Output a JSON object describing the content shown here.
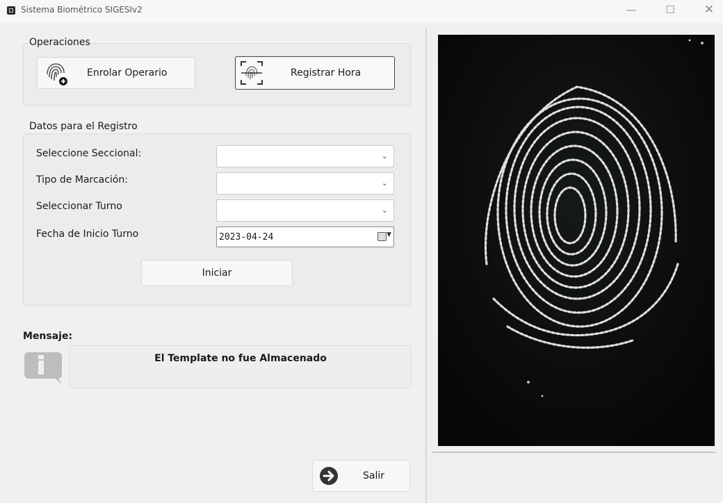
{
  "window": {
    "title": "Sistema Biométrico SIGESIv2",
    "min_glyph": "—",
    "max_glyph": "☐",
    "close_glyph": "✕"
  },
  "operations": {
    "title": "Operaciones",
    "enroll_label": "Enrolar Operario",
    "enroll_icon": "fingerprint-add-icon",
    "register_label": "Registrar Hora",
    "register_icon": "fingerprint-scan-icon"
  },
  "registro": {
    "title": "Datos para el Registro",
    "fields": [
      {
        "label": "Seleccione Seccional:",
        "value": ""
      },
      {
        "label": "Tipo de Marcación:",
        "value": ""
      },
      {
        "label": "Seleccionar Turno",
        "value": ""
      }
    ],
    "date_label": "Fecha de Inicio Turno",
    "date_value": "2023-04-24",
    "start_label": "Iniciar"
  },
  "message": {
    "title": "Mensaje:",
    "text": "El Template no fue Almacenado",
    "icon": "info-icon"
  },
  "exit": {
    "label": "Salir",
    "icon": "exit-arrow-icon"
  },
  "fingerprint": {
    "icon": "fingerprint-image"
  },
  "colors": {
    "background": "#f0f0f0",
    "image_background": "#0d0d0d"
  }
}
